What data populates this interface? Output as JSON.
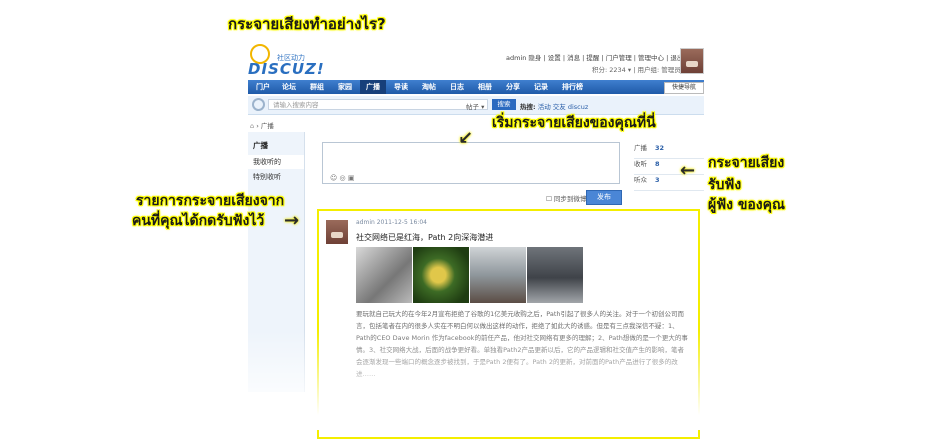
{
  "annotations": {
    "heading": "กระจายเสียงทำอย่างไร?",
    "start": "เริ่มกระจายเสียงของคุณที่นี่",
    "listen_1": "กระจายเสียง",
    "listen_2": "รับฟัง",
    "listen_3": "ผู้ฟัง ของคุณ",
    "feed_1": "รายการกระจายเสียงจาก",
    "feed_2": "คนที่คุณได้กดรับฟังไว้"
  },
  "logo": {
    "text": "DISCUZ!",
    "sub": "社区动力"
  },
  "userbar": {
    "links": "admin 隐身 | 设置 | 消息 | 提醒 | 门户管理 | 管理中心 | 退出",
    "points": "积分: 2234 ▾ | 用户组: 管理员"
  },
  "nav": {
    "items": [
      "门户",
      "论坛",
      "群组",
      "家园",
      "广播",
      "导读",
      "淘帖",
      "日志",
      "相册",
      "分享",
      "记录",
      "排行榜"
    ],
    "active": "广播",
    "quick": "快捷导航"
  },
  "search": {
    "placeholder": "请输入搜索内容",
    "type": "帖子 ▾",
    "button": "搜索",
    "hot_label": "热搜:",
    "hot_terms": "活动 交友 discuz"
  },
  "breadcrumb": "› 广播",
  "sidebar": {
    "title": "广播",
    "items": [
      "我收听的",
      "特别收听"
    ]
  },
  "composer": {
    "sync": "同步到微博",
    "publish": "发布",
    "tools": "☺ ◎ ▣"
  },
  "stats": [
    {
      "label": "广播",
      "value": "32"
    },
    {
      "label": "收听",
      "value": "8"
    },
    {
      "label": "听众",
      "value": "3"
    }
  ],
  "post": {
    "meta": "admin  2011-12-5 16:04",
    "title": "社交网络已是红海，Path 2向深海潜进",
    "body": "要玩就自己玩大的在今年2月宣布拒绝了谷歌的1亿美元收购之后，Path引起了很多人的关注。对于一个初创公司而言，包括笔者在内的很多人实在不明白何以做出这样的动作，拒绝了如此大的诱惑。但是有三点我深信不疑：1、Path的CEO Dave Morin 作为facebook的前任产品，他对社交网络有更多的理解；2、Path想做的是一个更大的事情。3、社交网络大战，后面的战争更好看。单独看Path2产品更新以后，它的产品逻辑和社交值产生的影响，笔者会逐渐发现一些端口的概念逐步被找到，于是Path 2便有了。Path 2的更新，对前面的Path产品进行了很多的改进……"
  },
  "colors": {
    "nav_blue": "#2b6ac0",
    "highlight_yellow": "#f4ee00"
  }
}
